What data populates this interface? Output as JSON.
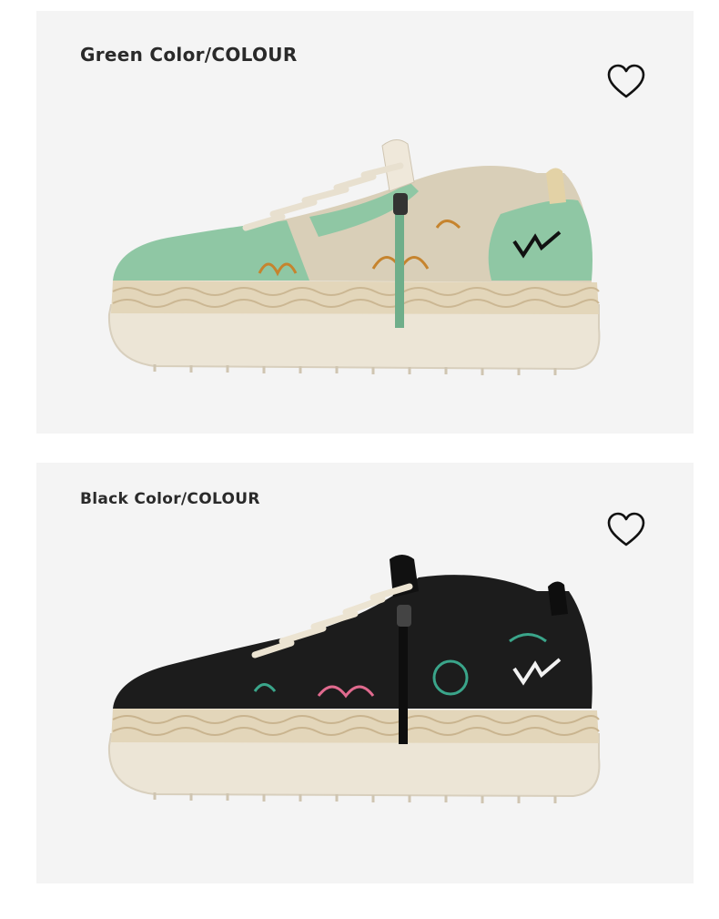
{
  "products": [
    {
      "id": "green",
      "label": "Green Color/COLOUR",
      "colors": {
        "upper": "#8fc7a4",
        "upper_dark": "#6fae8a",
        "pattern": "#d9cfb8",
        "accent": "#c6842e"
      },
      "icon": "heart-outline-icon"
    },
    {
      "id": "black",
      "label": "Black Color/COLOUR",
      "colors": {
        "upper": "#1c1c1c",
        "upper_dark": "#0e0e0e",
        "pattern": "#262626",
        "accent": "#3aa58a"
      },
      "icon": "heart-outline-icon"
    }
  ]
}
